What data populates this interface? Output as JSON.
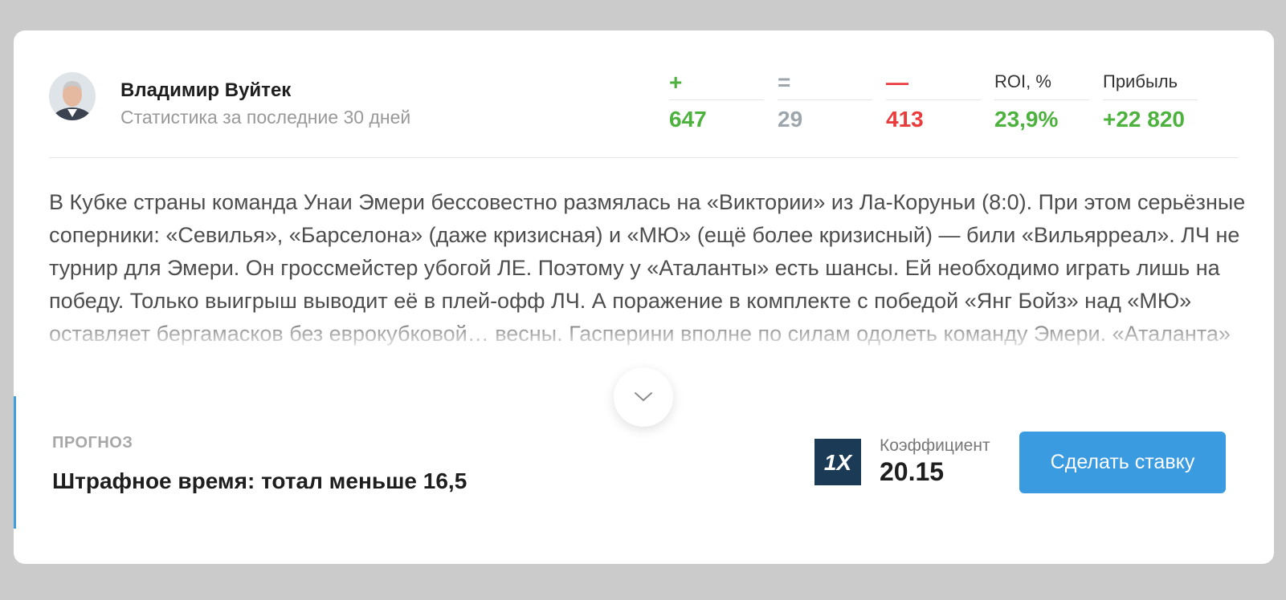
{
  "author": {
    "name": "Владимир Вуйтек",
    "subtitle": "Статистика за последние 30 дней"
  },
  "stats": [
    {
      "header": "+",
      "value": "647",
      "color": "#4cb13d"
    },
    {
      "header": "=",
      "value": "29",
      "color": "#9ea6ad"
    },
    {
      "header": "—",
      "value": "413",
      "color": "#ea3c3c"
    },
    {
      "header": "ROI, %",
      "value": "23,9%",
      "color": "#4cb13d"
    },
    {
      "header": "Прибыль",
      "value": "+22 820",
      "color": "#4cb13d"
    }
  ],
  "article_text": "В Кубке страны команда Унаи Эмери бессовестно размялась на «Виктории» из Ла-Коруньи (8:0). При этом серьёзные соперники: «Севилья», «Барселона» (даже кризисная) и «МЮ» (ещё более кризисный) — били «Вильярреал». ЛЧ не турнир для Эмери. Он гроссмейстер убогой ЛЕ. Поэтому у «Аталанты» есть шансы. Ей необходимо играть лишь на победу. Только выигрыш выводит её в плей-офф ЛЧ. А поражение в комплекте с победой «Янг Бойз» над «МЮ» оставляет бергамасков без еврокубковой… весны. Гасперини вполне по силам одолеть команду Эмери. «Аталанта» уже обыгрывала недавно",
  "expand_icon": "chevron-down-icon",
  "forecast": {
    "label": "ПРОГНОЗ",
    "value": "Штрафное время: тотал меньше 16,5"
  },
  "bookmaker": {
    "logo_text": "1X"
  },
  "coefficient": {
    "label": "Коэффициент",
    "value": "20.15"
  },
  "bet_button": {
    "label": "Сделать ставку",
    "color": "#3a9be0"
  }
}
